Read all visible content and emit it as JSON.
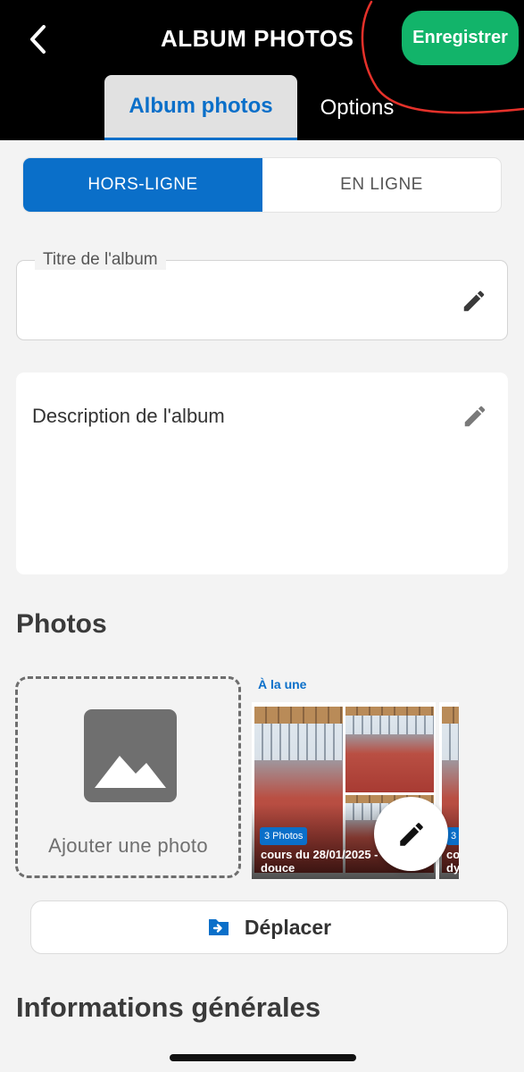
{
  "header": {
    "title": "ALBUM PHOTOS",
    "save_label": "Enregistrer",
    "back_icon": "chevron-left-icon"
  },
  "tabs": [
    {
      "label": "Album photos",
      "active": true
    },
    {
      "label": "Options",
      "active": false
    }
  ],
  "mode_toggle": {
    "options": [
      "HORS-LIGNE",
      "EN LIGNE"
    ],
    "selected": "HORS-LIGNE"
  },
  "form": {
    "title_label": "Titre de l'album",
    "title_value": "",
    "description_placeholder": "Description de l'album"
  },
  "photos": {
    "section_title": "Photos",
    "add_label": "Ajouter une photo",
    "featured_label": "À la une",
    "albums": [
      {
        "badge": "3 Photos",
        "caption": "cours du 28/01/2025 - \ndouce"
      },
      {
        "badge": "3",
        "caption": "co\ndy"
      }
    ],
    "move_label": "Déplacer"
  },
  "info": {
    "section_title": "Informations générales"
  },
  "colors": {
    "accent": "#0a6fc9",
    "save": "#12b46a",
    "annotation": "#e5312a"
  }
}
